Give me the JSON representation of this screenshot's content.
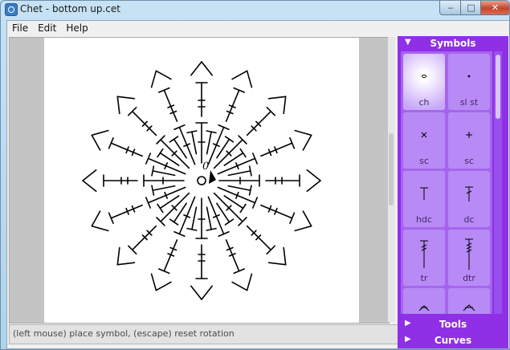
{
  "window": {
    "title": "Chet - bottom up.cet"
  },
  "menu": [
    {
      "label": "File"
    },
    {
      "label": "Edit"
    },
    {
      "label": "Help"
    }
  ],
  "status": {
    "text": "(left mouse) place symbol, (escape) reset rotation"
  },
  "panel": {
    "symbols_header": "Symbols",
    "tools_header": "Tools",
    "curves_header": "Curves",
    "symbols": [
      {
        "label": "ch",
        "icon": "chain-symbol-icon"
      },
      {
        "label": "sl st",
        "icon": "slip-stitch-symbol-icon"
      },
      {
        "label": "sc",
        "icon": "single-crochet-x-icon"
      },
      {
        "label": "sc",
        "icon": "single-crochet-plus-icon"
      },
      {
        "label": "hdc",
        "icon": "half-double-crochet-icon"
      },
      {
        "label": "dc",
        "icon": "double-crochet-icon"
      },
      {
        "label": "tr",
        "icon": "treble-crochet-icon"
      },
      {
        "label": "dtr",
        "icon": "double-treble-crochet-icon"
      }
    ]
  },
  "canvas": {
    "center_label": "0"
  },
  "colors": {
    "panel": "#8f2fe6",
    "palette": "#a761f0",
    "symbol_tile": "#b78af6",
    "ink": "#000000"
  }
}
